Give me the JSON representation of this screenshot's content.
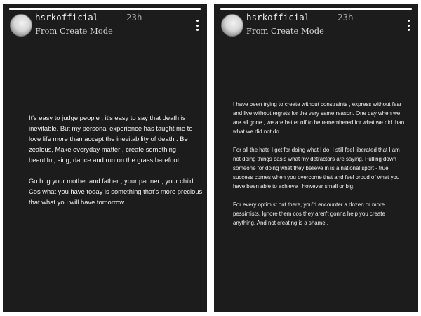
{
  "stories": [
    {
      "username": "hsrkofficial",
      "timestamp": "23h",
      "subtitle": "From Create Mode",
      "progress": 1.0,
      "paragraphs": [
        "It's easy to judge people , it's easy to say that death is inevitable. But my personal experience has taught me to love life more than accept the inevitability of death . Be zealous, Make everyday matter , create something beautiful, sing, dance and run on the grass barefoot.",
        "Go hug your mother and father , your partner , your child . Cos what you have today is something that's more precious that what you will have tomorrow ."
      ]
    },
    {
      "username": "hsrkofficial",
      "timestamp": "23h",
      "subtitle": "From Create Mode",
      "progress": 1.0,
      "paragraphs": [
        "I have been trying to create without constraints , express without fear and live without regrets for the very same reason. One day when we are all gone , we are better off to be remembered for what we did than what we did not do .",
        "For all the hate I get for doing what I do, I still feel liberated that I am not doing things basis what my detractors are saying. Pulling down someone for doing what they believe in is a national sport - true success comes when you overcome that and feel proud of what you have been able to achieve , however small or big.",
        "For every optimist out there, you'd encounter a dozen or more pessimists. Ignore them cos they aren't gonna help you create anything. And not creating is a shame ."
      ]
    }
  ]
}
